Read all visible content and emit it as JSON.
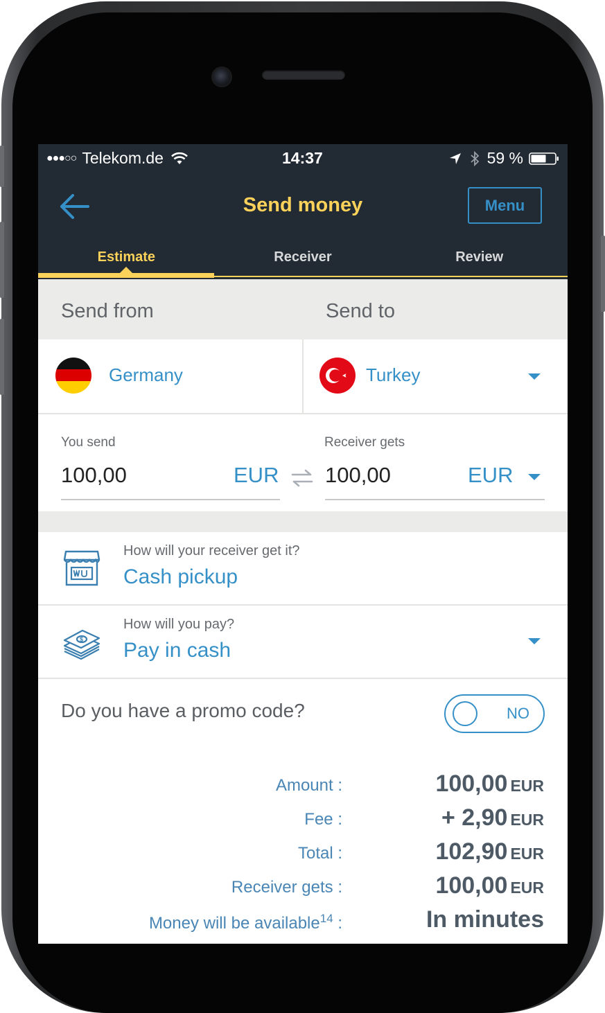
{
  "status_bar": {
    "signal": "●●●○○",
    "carrier": "Telekom.de",
    "time": "14:37",
    "battery": "59 %"
  },
  "header": {
    "title": "Send money",
    "menu_label": "Menu",
    "back_icon": "arrow-left-icon"
  },
  "tabs": [
    {
      "label": "Estimate",
      "active": true
    },
    {
      "label": "Receiver",
      "active": false
    },
    {
      "label": "Review",
      "active": false
    }
  ],
  "route": {
    "send_from_label": "Send from",
    "send_to_label": "Send to",
    "from_country": "Germany",
    "to_country": "Turkey"
  },
  "amounts": {
    "you_send_label": "You send",
    "you_send_value": "100,00",
    "you_send_currency": "EUR",
    "receiver_gets_label": "Receiver gets",
    "receiver_gets_value": "100,00",
    "receiver_gets_currency": "EUR"
  },
  "delivery": {
    "question": "How will your receiver get it?",
    "answer": "Cash pickup",
    "icon": "store-icon"
  },
  "payment": {
    "question": "How will you pay?",
    "answer": "Pay in cash",
    "icon": "cash-icon"
  },
  "promo": {
    "label": "Do you have a promo code?",
    "toggle_text": "NO"
  },
  "summary": [
    {
      "label": "Amount :",
      "value": "100,00",
      "currency": "EUR"
    },
    {
      "label": "Fee :",
      "value": "+ 2,90",
      "currency": "EUR"
    },
    {
      "label": "Total :",
      "value": "102,90",
      "currency": "EUR"
    },
    {
      "label": "Receiver gets :",
      "value": "100,00",
      "currency": "EUR"
    }
  ],
  "availability": {
    "label": "Money will be available",
    "footnote": "14",
    "colon": " :",
    "value": "In minutes"
  },
  "colors": {
    "header_bg": "#222a33",
    "accent_yellow": "#fdd25a",
    "accent_blue": "#3690c8"
  }
}
